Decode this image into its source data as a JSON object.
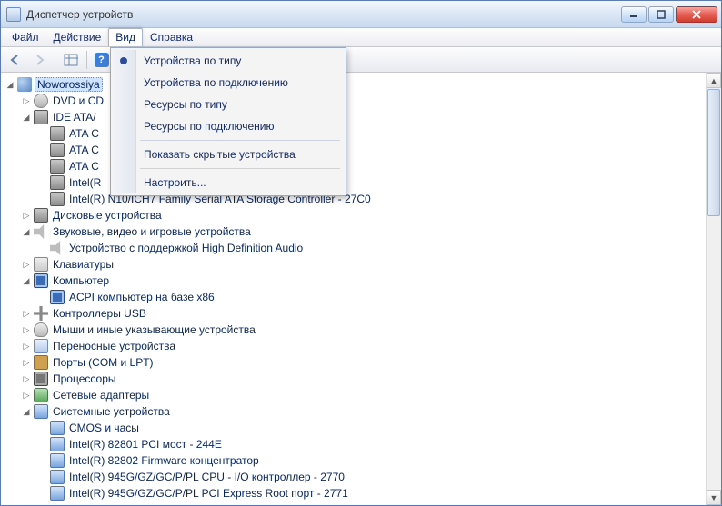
{
  "window": {
    "title": "Диспетчер устройств"
  },
  "menubar": {
    "items": [
      {
        "label": "Файл"
      },
      {
        "label": "Действие"
      },
      {
        "label": "Вид"
      },
      {
        "label": "Справка"
      }
    ]
  },
  "view_menu": {
    "items": [
      {
        "label": "Устройства по типу",
        "checked": true
      },
      {
        "label": "Устройства по подключению"
      },
      {
        "label": "Ресурсы по типу"
      },
      {
        "label": "Ресурсы по подключению"
      }
    ],
    "show_hidden": "Показать скрытые устройства",
    "customize": "Настроить..."
  },
  "tree": {
    "root": "Noworossiya",
    "dvd": {
      "label": "DVD и CD",
      "short": true
    },
    "ide": {
      "label": "IDE ATA/",
      "children": [
        "ATA C",
        "ATA C",
        "ATA C",
        "Intel(R",
        "Intel(R) N10/ICH7 Family Serial ATA Storage Controller - 27C0"
      ]
    },
    "disk": "Дисковые устройства",
    "sound": {
      "label": "Звуковые, видео и игровые устройства",
      "children": [
        "Устройство с поддержкой High Definition Audio"
      ]
    },
    "keyboard": "Клавиатуры",
    "computer": {
      "label": "Компьютер",
      "children": [
        "ACPI компьютер на базе x86"
      ]
    },
    "usb": "Контроллеры USB",
    "mouse": "Мыши и иные указывающие устройства",
    "portable": "Переносные устройства",
    "ports": "Порты (COM и LPT)",
    "cpu": "Процессоры",
    "net": "Сетевые адаптеры",
    "system": {
      "label": "Системные устройства",
      "children": [
        "CMOS и часы",
        "Intel(R) 82801 PCI мост - 244E",
        "Intel(R) 82802 Firmware концентратор",
        "Intel(R) 945G/GZ/GC/P/PL CPU - I/O контроллер - 2770",
        "Intel(R) 945G/GZ/GC/P/PL PCI Express Root порт - 2771"
      ]
    }
  }
}
